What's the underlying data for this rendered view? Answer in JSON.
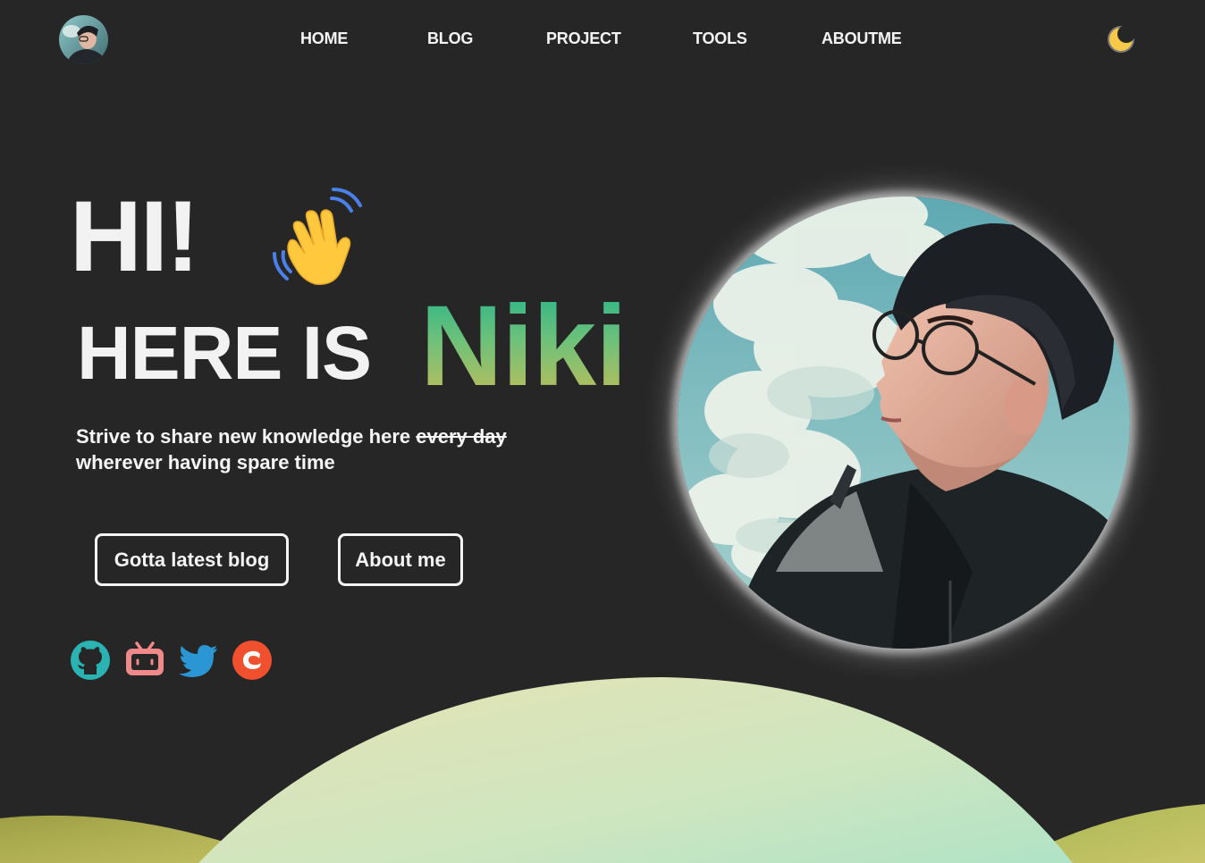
{
  "nav": {
    "avatar_alt": "Niki avatar",
    "links": [
      {
        "label": "HOME"
      },
      {
        "label": "BLOG"
      },
      {
        "label": "PROJECT"
      },
      {
        "label": "TOOLS"
      },
      {
        "label": "ABOUTME"
      }
    ],
    "theme_icon": "moon-icon"
  },
  "hero": {
    "greeting": "HI!",
    "wave_icon": "waving-hand-icon",
    "intro": "HERE IS",
    "name": "Niki",
    "tagline_part1": "Strive to share new knowledge here ",
    "tagline_struck": "every day",
    "tagline_part2": "wherever having spare time",
    "buttons": {
      "latest_blog": "Gotta latest blog",
      "about_me": "About me"
    }
  },
  "social": [
    {
      "icon": "github-icon",
      "color": "#2bb3b3"
    },
    {
      "icon": "bilibili-icon",
      "color": "#f08a8a"
    },
    {
      "icon": "twitter-icon",
      "color": "#2a97d4"
    },
    {
      "icon": "csdn-icon",
      "color": "#f0502d"
    }
  ],
  "colors": {
    "background": "#262626",
    "name_gradient_top": "#27b48a",
    "name_gradient_bottom": "#c8bd55",
    "hill_light": "#d8e6b8",
    "hill_dark": "#b8b44e"
  }
}
